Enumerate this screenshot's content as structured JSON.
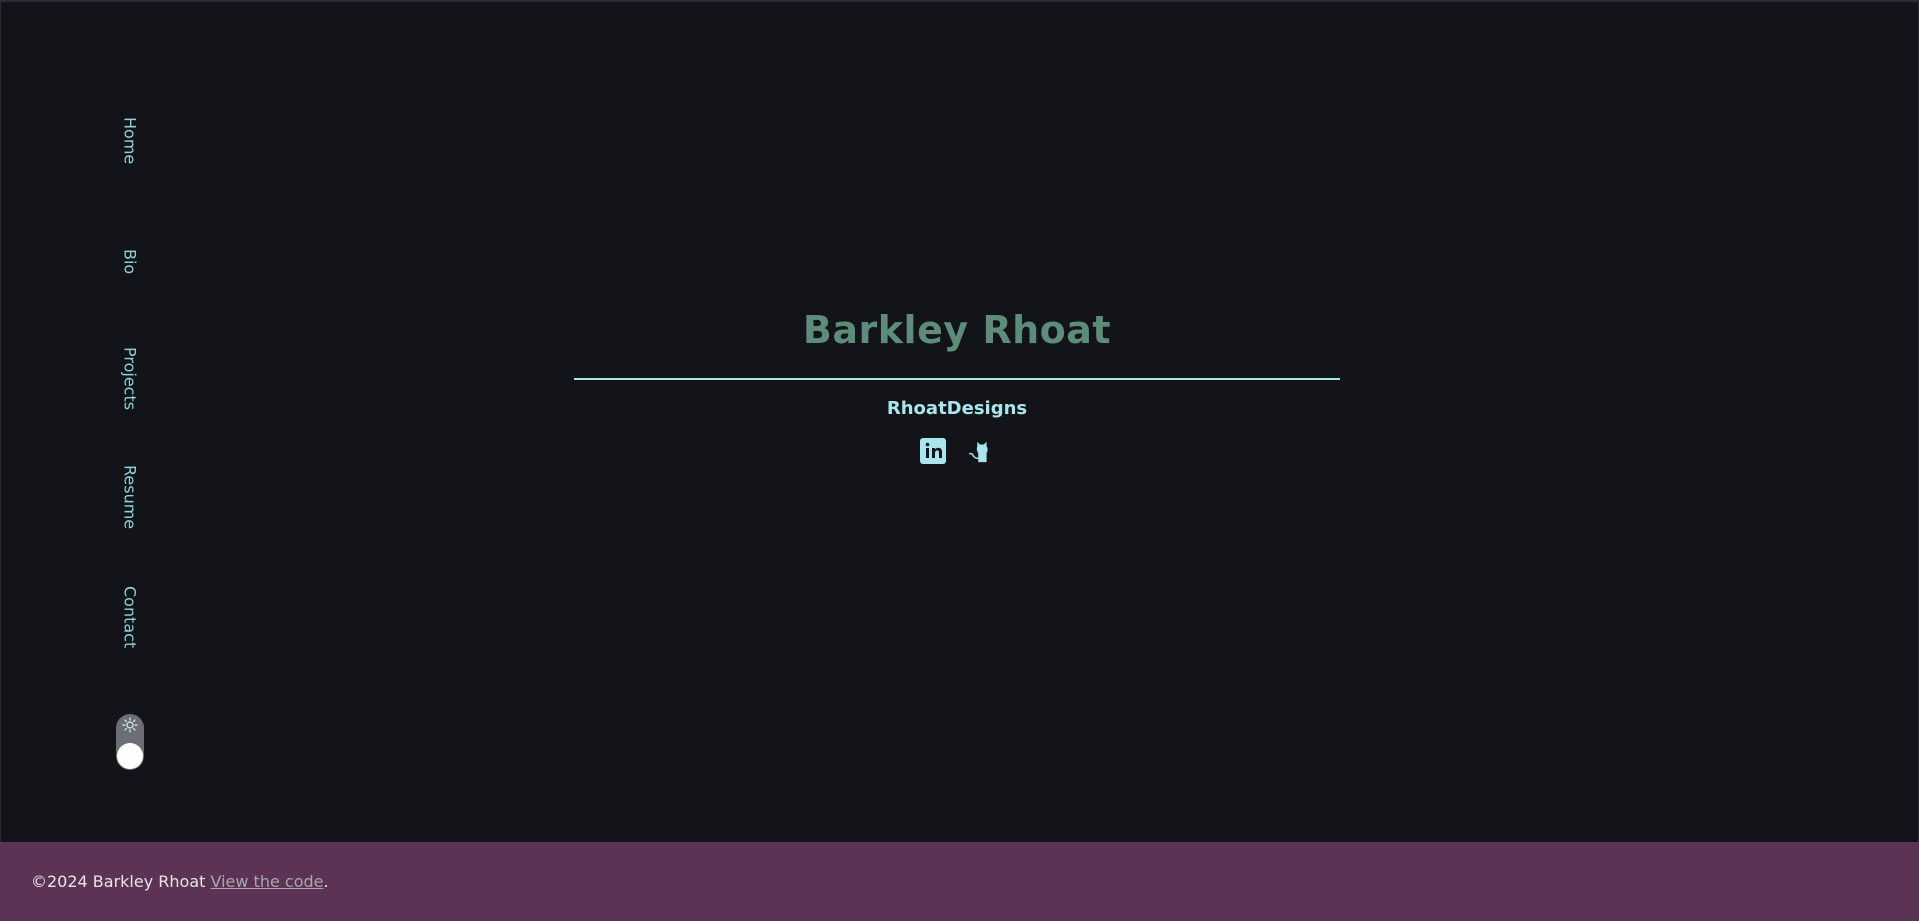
{
  "nav": {
    "items": [
      {
        "label": "Home"
      },
      {
        "label": "Bio"
      },
      {
        "label": "Projects"
      },
      {
        "label": "Resume"
      },
      {
        "label": "Contact"
      }
    ],
    "theme_toggle": {
      "icon": "sun-icon",
      "state": "dark"
    }
  },
  "hero": {
    "name": "Barkley Rhoat",
    "subtitle": "RhoatDesigns",
    "socials": [
      {
        "icon": "linkedin-icon"
      },
      {
        "icon": "github-icon"
      }
    ]
  },
  "footer": {
    "copyright": "©2024 Barkley Rhoat",
    "link_label": "View the code",
    "trailing": "."
  },
  "colors": {
    "background": "#121419",
    "accent": "#8ed2d9",
    "name": "#5e8c7a",
    "footer": "#5c3355"
  }
}
